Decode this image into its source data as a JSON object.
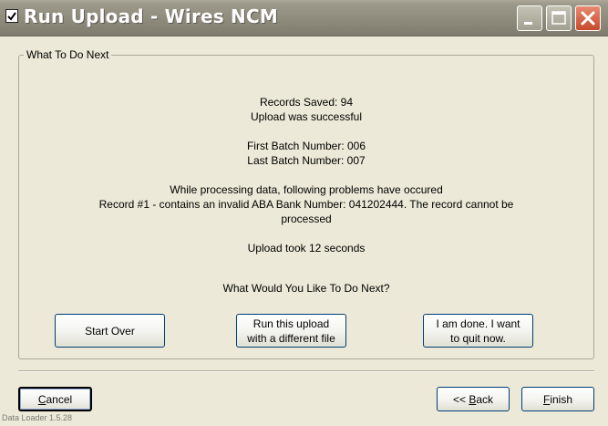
{
  "window": {
    "title": "Run Upload - Wires NCM",
    "icon": "checkbox-app-icon",
    "controls": [
      "minimize-icon",
      "maximize-icon",
      "close-icon"
    ]
  },
  "group": {
    "label": "What To Do Next"
  },
  "results": {
    "records_saved": "Records Saved: 94",
    "upload_status": "Upload was successful",
    "first_batch": "First Batch Number: 006",
    "last_batch": "Last Batch Number: 007",
    "problems_intro": "While processing data, following problems have occured",
    "problem_line1": "Record #1 - contains an invalid ABA Bank Number: 041202444.  The record cannot be",
    "problem_line2": "processed",
    "duration": "Upload took 12 seconds",
    "question": "What Would You Like To Do Next?"
  },
  "actions": {
    "start_over": "Start Over",
    "run_different_line1": "Run this upload",
    "run_different_line2": "with a different file",
    "done_line1": "I am done.  I want",
    "done_line2": "to quit now."
  },
  "footer": {
    "cancel_mnemonic": "C",
    "cancel_rest": "ancel",
    "back_prefix": "<< ",
    "back_mnemonic": "B",
    "back_rest": "ack",
    "finish_mnemonic": "F",
    "finish_rest": "inish",
    "version": "Data Loader 1.5.28"
  },
  "colors": {
    "window_bg": "#ECE9D8",
    "titlebar": "#8E8B7C",
    "close_button": "#C64A2C"
  }
}
